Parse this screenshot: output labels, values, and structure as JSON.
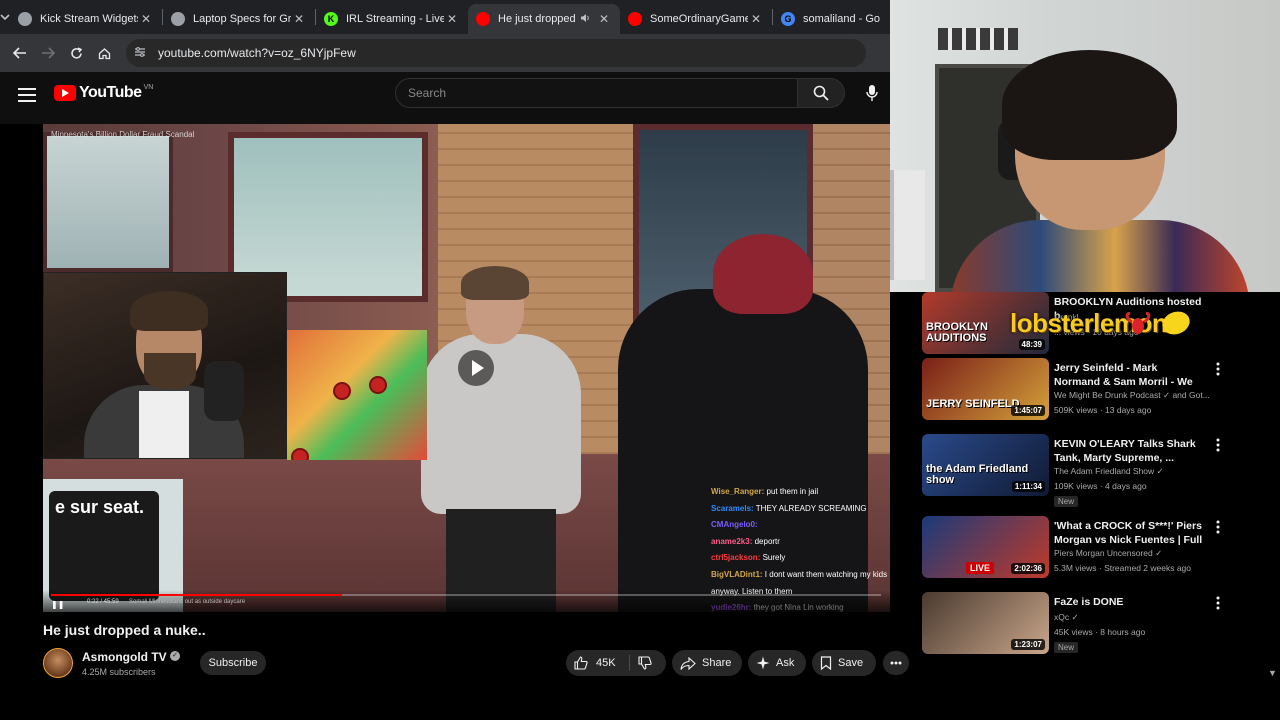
{
  "browser": {
    "tabs": [
      {
        "title": "Kick Stream Widgets",
        "favicon_color": "#9aa0a6",
        "favicon_text": ""
      },
      {
        "title": "Laptop Specs for Gr",
        "favicon_color": "#9aa0a6",
        "favicon_text": ""
      },
      {
        "title": "IRL Streaming - Live",
        "favicon_color": "#53fc18",
        "favicon_text": "K"
      },
      {
        "title": "He just dropped",
        "favicon_color": "#ff0000",
        "favicon_text": "",
        "active": true,
        "audio": true
      },
      {
        "title": "SomeOrdinaryGamer",
        "favicon_color": "#ff0000",
        "favicon_text": ""
      },
      {
        "title": "somaliland - Go",
        "favicon_color": "#4285f4",
        "favicon_text": "G"
      }
    ],
    "url": "youtube.com/watch?v=oz_6NYjpFew"
  },
  "youtube": {
    "logo": "YouTube",
    "country_code": "VN",
    "search_placeholder": "Search"
  },
  "player": {
    "overlay_text": "Minnesota's Billion Dollar Fraud Scandal",
    "kiosk_sign": "e sur seat.",
    "time": "0:22 / 45:59",
    "chapter": "Somali Minnesotans out as outside daycare",
    "progress": 0.35,
    "chat": [
      {
        "name": "Wise_Ranger:",
        "color": "#d4a84a",
        "msg": "put them in jail"
      },
      {
        "name": "Scaramels:",
        "color": "#2c8bff",
        "msg": "THEY ALREADY SCREAMING"
      },
      {
        "name": "CMAngelo0:",
        "color": "#7a5cff",
        "msg": ""
      },
      {
        "name": "aname2k3:",
        "color": "#ff5c8a",
        "msg": "deportr"
      },
      {
        "name": "ctrl5jackson:",
        "color": "#ff3b3b",
        "msg": "Surely"
      },
      {
        "name": "BigVLADint1:",
        "color": "#d4a84a",
        "msg": "I dont want them watching my kids"
      },
      {
        "name": "",
        "color": "#ffffff",
        "msg": "anyway. Listen to them"
      },
      {
        "name": "yudie26hr:",
        "color": "#b05cff",
        "msg": "they got Nina Lin working"
      }
    ]
  },
  "video": {
    "title": "He just dropped a nuke..",
    "channel": "Asmongold TV",
    "subscribers": "4.25M subscribers",
    "subscribe_label": "Subscribe",
    "likes": "45K",
    "share_label": "Share",
    "ask_label": "Ask",
    "save_label": "Save"
  },
  "overlay": {
    "lobster_text": "lobsterlemon"
  },
  "recommendations": [
    {
      "title": "BROOKLYN Auditions hosted b...",
      "channel": "Drunkl",
      "meta": "... views · 10 days ago",
      "duration": "48:39",
      "thumb_text": "BROOKLYN AUDITIONS",
      "thumb_colors": [
        "#b33a2a",
        "#1f2a3a"
      ],
      "badge": ""
    },
    {
      "title": "Jerry Seinfeld - Mark Normand & Sam Morril - We Might Be ...",
      "channel": "We Might Be Drunk Podcast ✓ and Got...",
      "meta": "509K views · 13 days ago",
      "duration": "1:45:07",
      "thumb_text": "JERRY SEINFELD",
      "thumb_colors": [
        "#7a1f18",
        "#d4a13a"
      ],
      "badge": ""
    },
    {
      "title": "KEVIN O'LEARY Talks Shark Tank, Marty Supreme, ...",
      "channel": "The Adam Friedland Show ✓",
      "meta": "109K views · 4 days ago",
      "duration": "1:11:34",
      "thumb_text": "the Adam Friedland show",
      "thumb_colors": [
        "#2a4a8a",
        "#101a34"
      ],
      "badge": "New"
    },
    {
      "title": "'What a CROCK of S***!' Piers Morgan vs Nick Fuentes | Full ...",
      "channel": "Piers Morgan Uncensored ✓",
      "meta": "5.3M views · Streamed 2 weeks ago",
      "duration": "2:02:36",
      "live": "LIVE",
      "thumb_text": "",
      "thumb_colors": [
        "#1a3a7a",
        "#c03a2a"
      ],
      "badge": ""
    },
    {
      "title": "FaZe is DONE",
      "channel": "xQc ✓",
      "meta": "45K views · 8 hours ago",
      "duration": "1:23:07",
      "thumb_text": "",
      "thumb_colors": [
        "#4a3a30",
        "#c9a68a"
      ],
      "badge": "New"
    }
  ]
}
